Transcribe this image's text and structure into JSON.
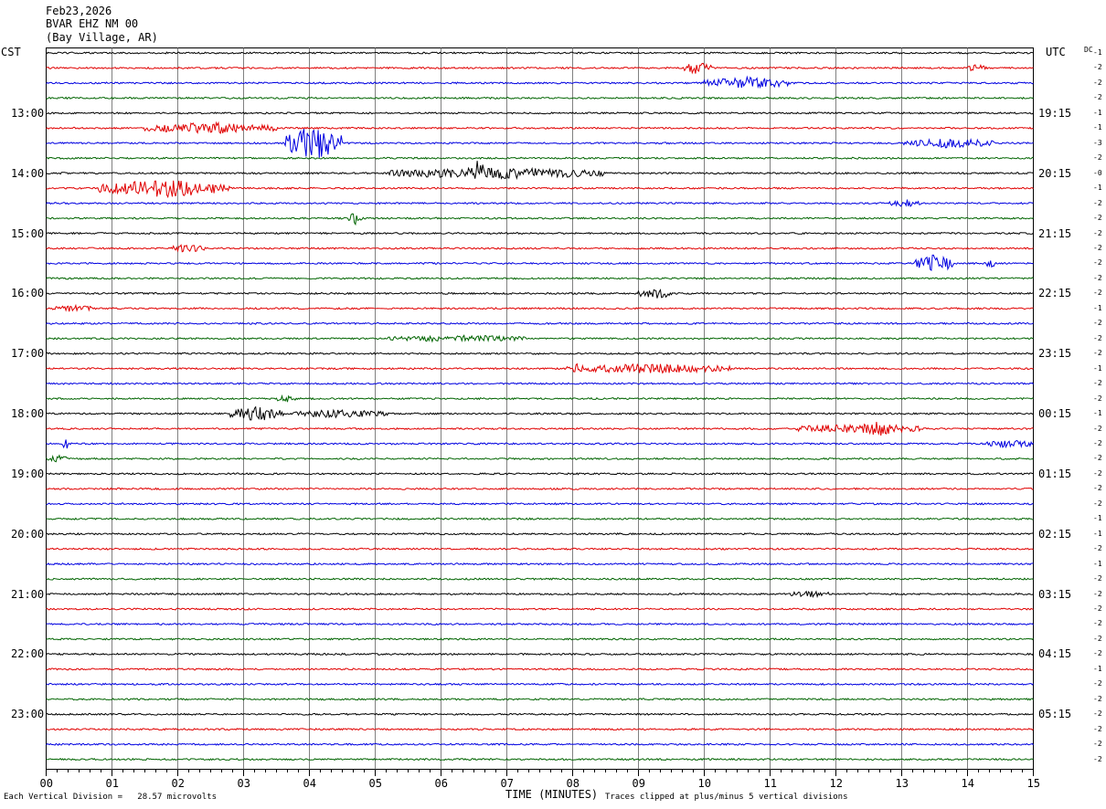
{
  "header": {
    "date": "Feb23,2026",
    "station": "BVAR EHZ NM 00",
    "location": "(Bay Village, AR)"
  },
  "left_zone": "CST",
  "right_zone": "UTC",
  "dc_label": "DC",
  "footer": {
    "scale_note": "Each Vertical Division =   28.57 microvolts",
    "clip_note": "Traces clipped at plus/minus 5 vertical divisions"
  },
  "colors": {
    "trace_cycle": [
      "#000000",
      "#e00000",
      "#0000e0",
      "#006400"
    ],
    "grid": "#808080"
  },
  "chart_data": {
    "type": "line",
    "title": "",
    "xlabel": "TIME (MINUTES)",
    "ylabel": "",
    "xlim": [
      0,
      15
    ],
    "x_ticks": [
      "00",
      "01",
      "02",
      "03",
      "04",
      "05",
      "06",
      "07",
      "08",
      "09",
      "10",
      "11",
      "12",
      "13",
      "14",
      "15"
    ],
    "left_hour_labels": [
      "13:00",
      "14:00",
      "15:00",
      "16:00",
      "17:00",
      "18:00",
      "19:00",
      "20:00",
      "21:00",
      "22:00",
      "23:00"
    ],
    "right_hour_labels": [
      "19:15",
      "20:15",
      "21:15",
      "22:15",
      "23:15",
      "00:15",
      "01:15",
      "02:15",
      "03:15",
      "04:15",
      "05:15"
    ],
    "dc_offsets": [
      -1,
      -2,
      -2,
      -2,
      -1,
      -1,
      -3,
      -2,
      0,
      -1,
      -2,
      -2,
      -2,
      -2,
      -2,
      -2,
      -2,
      -1,
      -2,
      -2,
      -2,
      -1,
      -2,
      -2,
      -1,
      -2,
      -2,
      -2,
      -2,
      -2,
      -2,
      -1,
      -1,
      -2,
      -1,
      -2,
      -2,
      -2,
      -2,
      -2,
      -2,
      -1,
      -2,
      -2,
      -2,
      -2,
      -2,
      -2
    ],
    "events": [
      {
        "row": 1,
        "start_min": 9.7,
        "end_min": 10.1,
        "amp": 2.0
      },
      {
        "row": 1,
        "start_min": 14.0,
        "end_min": 14.3,
        "amp": 1.2
      },
      {
        "row": 2,
        "start_min": 10.0,
        "end_min": 11.3,
        "amp": 2.0
      },
      {
        "row": 5,
        "start_min": 1.5,
        "end_min": 3.5,
        "amp": 1.8
      },
      {
        "row": 6,
        "start_min": 3.6,
        "end_min": 4.5,
        "amp": 6.0
      },
      {
        "row": 6,
        "start_min": 13.0,
        "end_min": 14.4,
        "amp": 1.5
      },
      {
        "row": 8,
        "start_min": 5.2,
        "end_min": 8.5,
        "amp": 1.8
      },
      {
        "row": 8,
        "start_min": 6.3,
        "end_min": 6.8,
        "amp": 4.5
      },
      {
        "row": 9,
        "start_min": 0.8,
        "end_min": 2.8,
        "amp": 3.0
      },
      {
        "row": 10,
        "start_min": 12.8,
        "end_min": 13.3,
        "amp": 1.2
      },
      {
        "row": 11,
        "start_min": 4.6,
        "end_min": 4.8,
        "amp": 2.0
      },
      {
        "row": 13,
        "start_min": 1.9,
        "end_min": 2.4,
        "amp": 1.2
      },
      {
        "row": 14,
        "start_min": 13.2,
        "end_min": 13.8,
        "amp": 3.0
      },
      {
        "row": 14,
        "start_min": 14.3,
        "end_min": 14.4,
        "amp": 2.0
      },
      {
        "row": 16,
        "start_min": 9.0,
        "end_min": 9.5,
        "amp": 1.8
      },
      {
        "row": 17,
        "start_min": 0.1,
        "end_min": 0.7,
        "amp": 1.0
      },
      {
        "row": 19,
        "start_min": 5.2,
        "end_min": 7.3,
        "amp": 1.0
      },
      {
        "row": 21,
        "start_min": 7.9,
        "end_min": 10.4,
        "amp": 1.5
      },
      {
        "row": 21,
        "start_min": 8.0,
        "end_min": 8.1,
        "amp": 2.5
      },
      {
        "row": 23,
        "start_min": 3.5,
        "end_min": 3.8,
        "amp": 1.2
      },
      {
        "row": 24,
        "start_min": 2.8,
        "end_min": 3.6,
        "amp": 2.5
      },
      {
        "row": 24,
        "start_min": 3.7,
        "end_min": 5.2,
        "amp": 1.2
      },
      {
        "row": 25,
        "start_min": 11.4,
        "end_min": 13.3,
        "amp": 1.5
      },
      {
        "row": 25,
        "start_min": 12.4,
        "end_min": 12.9,
        "amp": 2.5
      },
      {
        "row": 26,
        "start_min": 0.25,
        "end_min": 0.35,
        "amp": 2.0
      },
      {
        "row": 26,
        "start_min": 14.3,
        "end_min": 15.0,
        "amp": 1.2
      },
      {
        "row": 27,
        "start_min": 0.0,
        "end_min": 0.3,
        "amp": 1.2
      },
      {
        "row": 36,
        "start_min": 11.3,
        "end_min": 11.9,
        "amp": 0.8
      }
    ]
  }
}
